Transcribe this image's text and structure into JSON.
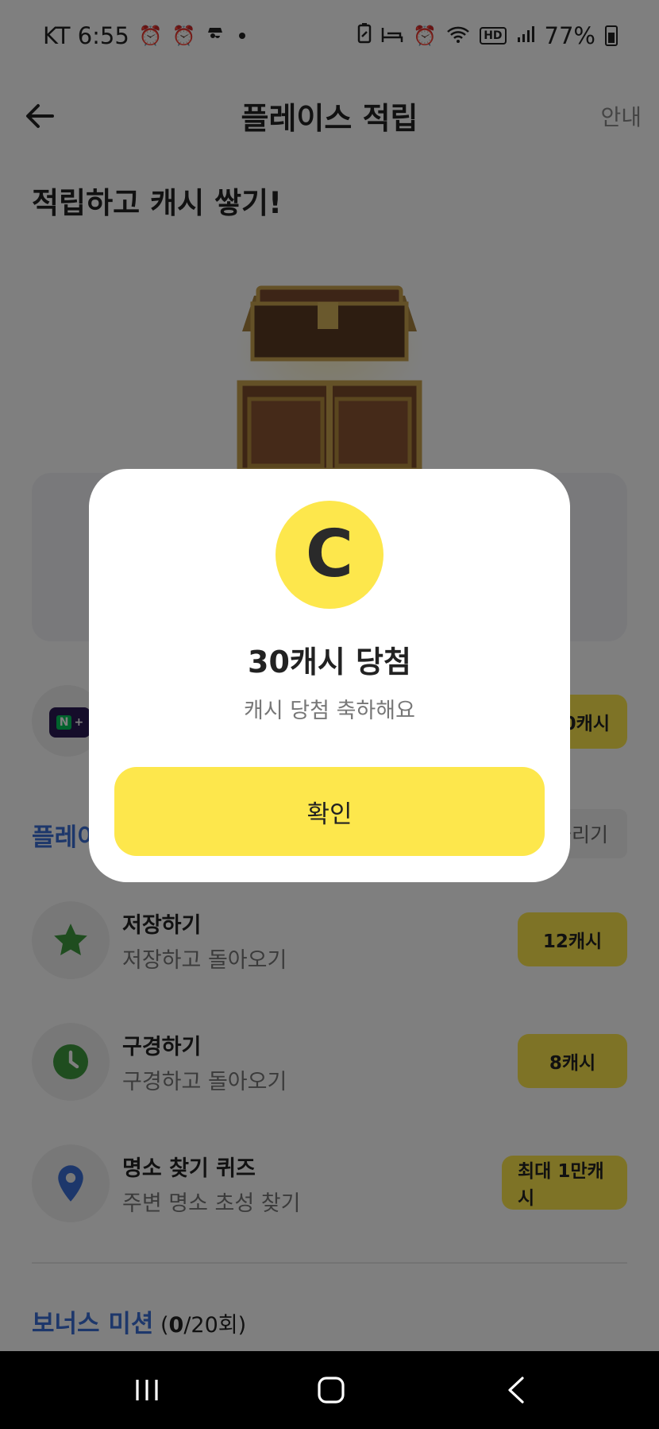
{
  "status_bar": {
    "carrier_time": "KT 6:55",
    "battery_percent": "77%",
    "left_icons": [
      "alarm-icon",
      "alarm-snooze-icon",
      "spy-icon"
    ],
    "right_icons": [
      "battery-saver-icon",
      "sleep-icon",
      "alarm-icon",
      "wifi-icon",
      "hd-icon",
      "signal-icon",
      "battery-icon"
    ],
    "hd_label": "HD"
  },
  "header": {
    "title": "플레이스 적립",
    "guide_link": "안내"
  },
  "hero": {
    "title": "적립하고 캐시 쌓기!"
  },
  "promo": {
    "reward": "0캐시"
  },
  "missions_section": {
    "title": "플레이",
    "chip": "늘리기"
  },
  "missions": [
    {
      "title": "저장하기",
      "subtitle": "저장하고 돌아오기",
      "reward": "12캐시",
      "icon": "star-icon"
    },
    {
      "title": "구경하기",
      "subtitle": "구경하고 돌아오기",
      "reward": "8캐시",
      "icon": "clock-icon"
    },
    {
      "title": "명소 찾기 퀴즈",
      "subtitle": "주변 명소 초성 찾기",
      "reward": "최대 1만캐시",
      "icon": "location-pin-icon"
    }
  ],
  "bonus": {
    "title": "보너스 미션",
    "count_open": " (",
    "count_done": "0",
    "count_total": "/20회)"
  },
  "modal": {
    "coin_letter": "C",
    "title": "30캐시 당첨",
    "subtitle": "캐시 당첨 축하해요",
    "confirm": "확인"
  },
  "colors": {
    "accent_yellow": "#fde74c",
    "link_blue": "#3a6fd6"
  }
}
